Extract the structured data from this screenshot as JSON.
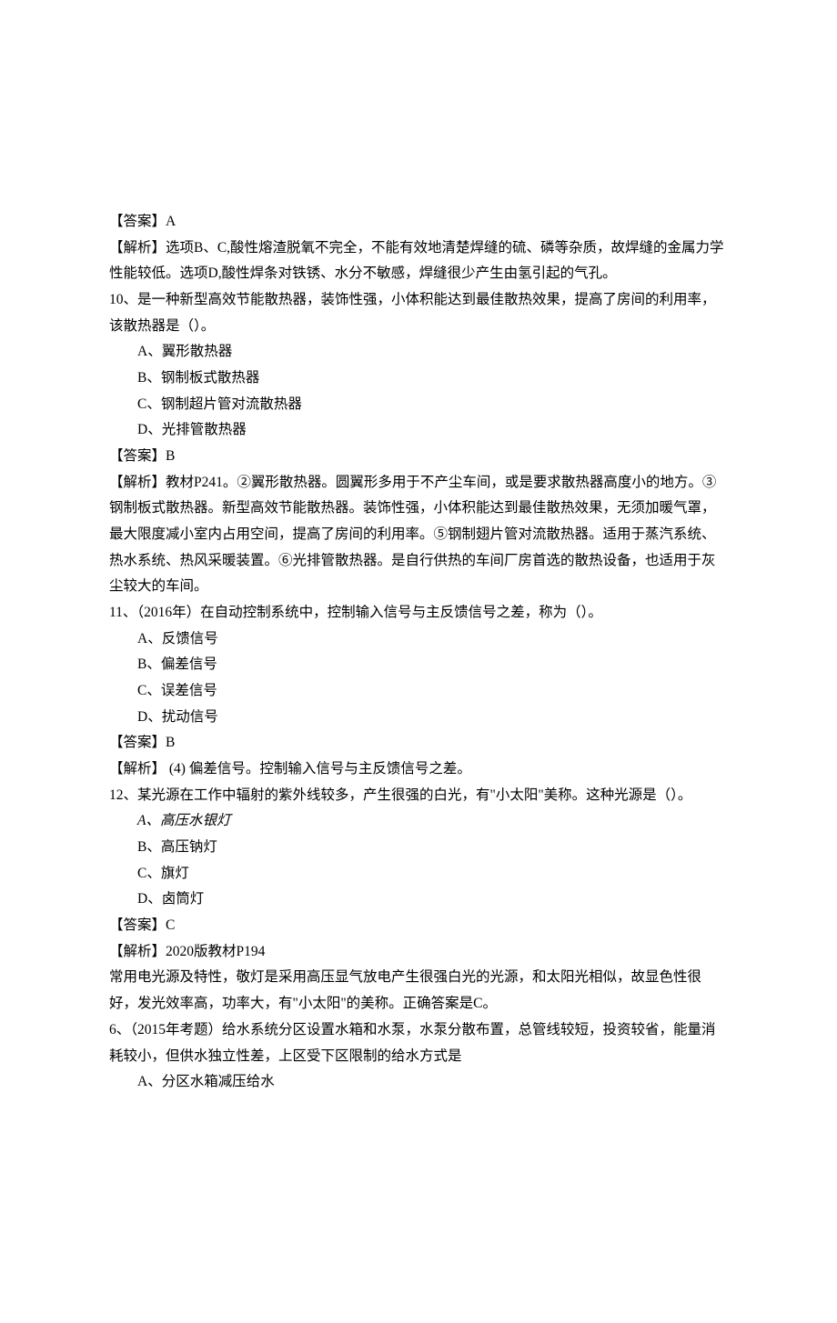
{
  "lines": [
    {
      "text": "【答案】A",
      "indent": false
    },
    {
      "text": "【解析】选项B、C,酸性熔渣脱氧不完全，不能有效地清楚焊缝的硫、磷等杂质，故焊缝的金属力学性能较低。选项D,酸性焊条对铁锈、水分不敏感，焊缝很少产生由氢引起的气孔。",
      "indent": false
    },
    {
      "text": "10、是一种新型高效节能散热器，装饰性强，小体积能达到最佳散热效果，提高了房间的利用率，该散热器是（）。",
      "indent": false
    },
    {
      "text": "A、翼形散热器",
      "indent": true
    },
    {
      "text": "B、钢制板式散热器",
      "indent": true
    },
    {
      "text": "C、钢制超片管对流散热器",
      "indent": true
    },
    {
      "text": "D、光排管散热器",
      "indent": true
    },
    {
      "text": "【答案】B",
      "indent": false
    },
    {
      "text": "【解析】教材P241。②翼形散热器。圆翼形多用于不产尘车间，或是要求散热器高度小的地方。③钢制板式散热器。新型高效节能散热器。装饰性强，小体积能达到最佳散热效果，无须加暖气罩，最大限度减小室内占用空间，提高了房间的利用率。⑤钢制翅片管对流散热器。适用于蒸汽系统、热水系统、热风采暖装置。⑥光排管散热器。是自行供热的车间厂房首选的散热设备，也适用于灰尘较大的车间。",
      "indent": false
    },
    {
      "text": "11、（2016年）在自动控制系统中，控制输入信号与主反馈信号之差，称为（）。",
      "indent": false
    },
    {
      "text": "A、反馈信号",
      "indent": true
    },
    {
      "text": "B、偏差信号",
      "indent": true
    },
    {
      "text": "C、误差信号",
      "indent": true
    },
    {
      "text": "D、扰动信号",
      "indent": true
    },
    {
      "text": "【答案】B",
      "indent": false
    },
    {
      "text": "【解析】 (4) 偏差信号。控制输入信号与主反馈信号之差。",
      "indent": false
    },
    {
      "text": "12、某光源在工作中辐射的紫外线较多，产生很强的白光，有\"小太阳\"美称。这种光源是（）。",
      "indent": false
    },
    {
      "text": "A、高压水银灯",
      "indent": true,
      "italic": true
    },
    {
      "text": "B、高压钠灯",
      "indent": true
    },
    {
      "text": "C、旗灯",
      "indent": true
    },
    {
      "text": "D、卤筒灯",
      "indent": true
    },
    {
      "text": "【答案】C",
      "indent": false
    },
    {
      "text": "【解析】2020版教材P194",
      "indent": false
    },
    {
      "text": "常用电光源及特性，敬灯是采用高压显气放电产生很强白光的光源，和太阳光相似，故显色性很好，发光效率高，功率大，有\"小太阳\"的美称。正确答案是C。",
      "indent": false
    },
    {
      "text": "6、（2015年考题）给水系统分区设置水箱和水泵，水泵分散布置，总管线较短，投资较省，能量消耗较小，但供水独立性差，上区受下区限制的给水方式是",
      "indent": false
    },
    {
      "text": "A、分区水箱减压给水",
      "indent": true
    }
  ]
}
